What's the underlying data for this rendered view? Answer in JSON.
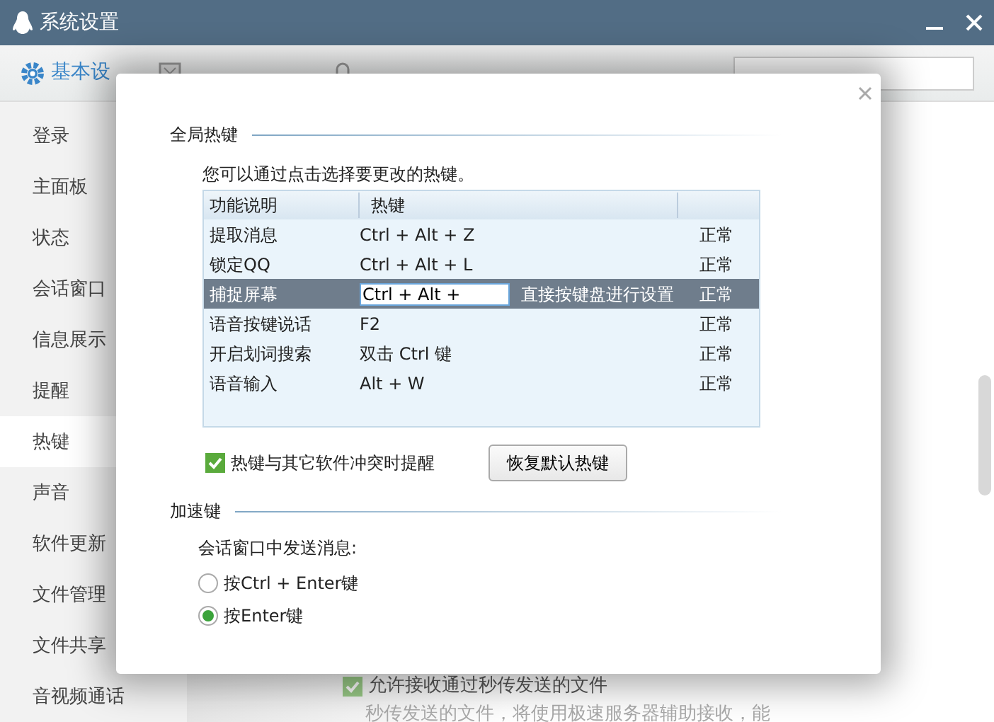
{
  "window": {
    "title": "系统设置"
  },
  "tabs": [
    {
      "label": "基本设",
      "selected": true
    }
  ],
  "sidebar": {
    "items": [
      {
        "label": "登录",
        "selected": false
      },
      {
        "label": "主面板",
        "selected": false
      },
      {
        "label": "状态",
        "selected": false
      },
      {
        "label": "会话窗口",
        "selected": false
      },
      {
        "label": "信息展示",
        "selected": false
      },
      {
        "label": "提醒",
        "selected": false
      },
      {
        "label": "热键",
        "selected": true
      },
      {
        "label": "声音",
        "selected": false
      },
      {
        "label": "软件更新",
        "selected": false
      },
      {
        "label": "文件管理",
        "selected": false
      },
      {
        "label": "文件共享",
        "selected": false
      },
      {
        "label": "音视频通话",
        "selected": false
      }
    ]
  },
  "background": {
    "option": {
      "label": "允许接收通过秒传发送的文件",
      "checked": true
    },
    "hint": "秒传发送的文件，将使用极速服务器辅助接收，能"
  },
  "dialog": {
    "sections": [
      {
        "heading": "全局热键"
      },
      {
        "heading": "加速键"
      }
    ],
    "description": "您可以通过点击选择要更改的热键。",
    "table": {
      "columns": [
        "功能说明",
        "热键"
      ],
      "rows": [
        {
          "function": "提取消息",
          "hotkey": "Ctrl + Alt + Z",
          "status": "正常",
          "selected": false
        },
        {
          "function": "锁定QQ",
          "hotkey": "Ctrl + Alt + L",
          "status": "正常",
          "selected": false
        },
        {
          "function": "捕捉屏幕",
          "hotkey": "Ctrl + Alt + ",
          "hint": "直接按键盘进行设置",
          "status": "正常",
          "selected": true
        },
        {
          "function": "语音按键说话",
          "hotkey": "F2",
          "status": "正常",
          "selected": false
        },
        {
          "function": "开启划词搜索",
          "hotkey": "双击 Ctrl 键",
          "status": "正常",
          "selected": false
        },
        {
          "function": "语音输入",
          "hotkey": "Alt + W",
          "status": "正常",
          "selected": false
        }
      ]
    },
    "conflict_option": {
      "label": "热键与其它软件冲突时提醒",
      "checked": true
    },
    "restore_button": "恢复默认热键",
    "send_prompt": "会话窗口中发送消息:",
    "send_options": [
      {
        "label": "按Ctrl + Enter键",
        "selected": false
      },
      {
        "label": "按Enter键",
        "selected": true
      }
    ]
  }
}
